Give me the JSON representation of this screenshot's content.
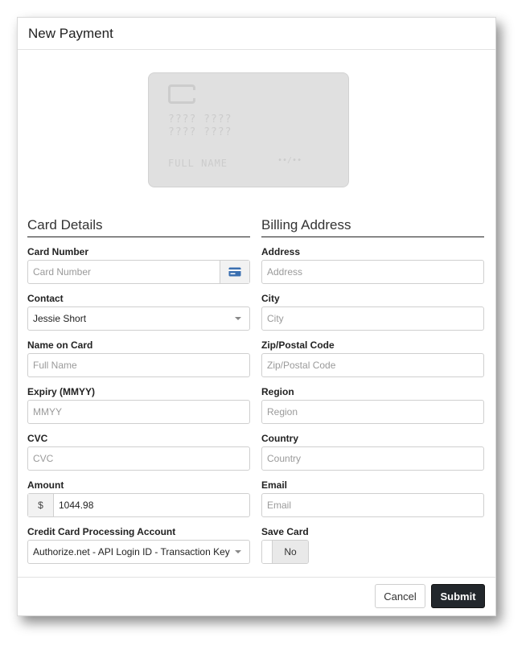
{
  "dialog": {
    "title": "New Payment"
  },
  "card_preview": {
    "number_row1": "???? ????",
    "number_row2": "???? ????",
    "name": "FULL NAME",
    "expiry": "••/••"
  },
  "card_details": {
    "heading": "Card Details",
    "card_number": {
      "label": "Card Number",
      "placeholder": "Card Number"
    },
    "contact": {
      "label": "Contact",
      "value": "Jessie Short"
    },
    "name_on_card": {
      "label": "Name on Card",
      "placeholder": "Full Name"
    },
    "expiry": {
      "label": "Expiry (MMYY)",
      "placeholder": "MMYY"
    },
    "cvc": {
      "label": "CVC",
      "placeholder": "CVC"
    },
    "amount": {
      "label": "Amount",
      "currency": "$",
      "value": "1044.98"
    },
    "processing_account": {
      "label": "Credit Card Processing Account",
      "value": "Authorize.net - API Login ID - Transaction Key"
    }
  },
  "billing_address": {
    "heading": "Billing Address",
    "address": {
      "label": "Address",
      "placeholder": "Address"
    },
    "city": {
      "label": "City",
      "placeholder": "City"
    },
    "zip": {
      "label": "Zip/Postal Code",
      "placeholder": "Zip/Postal Code"
    },
    "region": {
      "label": "Region",
      "placeholder": "Region"
    },
    "country": {
      "label": "Country",
      "placeholder": "Country"
    },
    "email": {
      "label": "Email",
      "placeholder": "Email"
    },
    "save_card": {
      "label": "Save Card",
      "state": "No"
    }
  },
  "footer": {
    "cancel": "Cancel",
    "submit": "Submit"
  },
  "icons": {
    "card_number_addon": "credit-card-icon",
    "select_arrow": "caret-down-icon"
  },
  "colors": {
    "submit_bg": "#22272c",
    "card_icon": "#3a6fb0",
    "card_preview_bg": "#e0e0e0"
  }
}
